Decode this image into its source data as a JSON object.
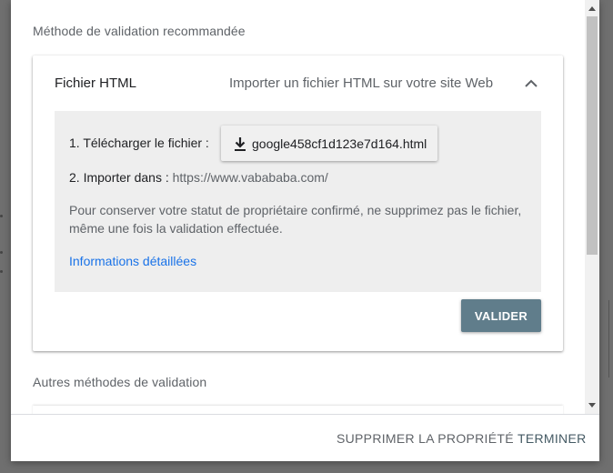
{
  "dialog": {
    "recommended_label": "Méthode de validation recommandée",
    "other_label": "Autres méthodes de validation"
  },
  "card": {
    "title": "Fichier HTML",
    "subtitle": "Importer un fichier HTML sur votre site Web",
    "chevron_icon": "chevron-up-icon"
  },
  "steps": {
    "step1_label": "1. Télécharger le fichier :",
    "download_icon": "download-icon",
    "download_filename": "google458cf1d123e7d164.html",
    "step2_label": "2. Importer dans :",
    "step2_url": "https://www.vabababa.com/",
    "note": "Pour conserver votre statut de propriétaire confirmé, ne supprimez pas le fichier, même une fois la validation effectuée.",
    "details_link": "Informations détaillées"
  },
  "actions": {
    "validate": "VALIDER"
  },
  "footer": {
    "delete_property": "SUPPRIMER LA PROPRIÉTÉ",
    "finish": "TERMINER"
  },
  "colors": {
    "accent_link": "#1a73e8",
    "validate_button": "#607d8b",
    "steps_background": "#eeeeee"
  }
}
